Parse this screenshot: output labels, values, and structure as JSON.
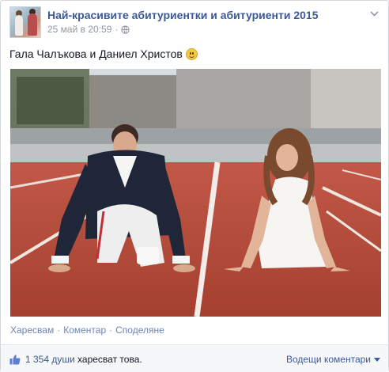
{
  "post": {
    "page_name": "Най-красивите абитуриентки и абитуриенти 2015",
    "date": "25 май в 20:59",
    "meta_separator": "·",
    "caption": "Гала Чалъкова и Даниел Христов",
    "caption_emoji": "smiley-icon"
  },
  "actions": {
    "like": "Харесвам",
    "comment": "Коментар",
    "share": "Споделяне",
    "separator": "·"
  },
  "footer": {
    "likes_count": "1 354 души",
    "likes_suffix": "харесват това.",
    "comments_sort": "Водещи коментари",
    "sort_icon": "caret-down-icon",
    "like_icon": "thumbs-up-icon"
  },
  "colors": {
    "link": "#3b5998",
    "action_link": "#6d84b4",
    "meta": "#9197a3",
    "track": "#b5483a"
  }
}
